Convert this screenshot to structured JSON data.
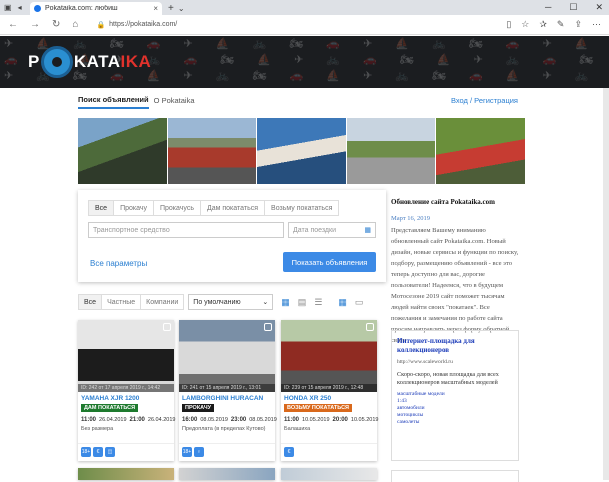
{
  "browser": {
    "tab_title": "Pokataika.com: любиш",
    "url": "https://pokataika.com/",
    "colors": {
      "tabbar": "#dee1e6",
      "accent": "#1a73e8"
    }
  },
  "site": {
    "logo_p": "P",
    "logo_kata": "KATA",
    "logo_ika": "IKA"
  },
  "subnav": {
    "search": "Поиск объявлений",
    "about": "О Pokataika",
    "login": "Вход / Регистрация"
  },
  "search": {
    "tabs": [
      "Все",
      "Прокачу",
      "Прокачусь",
      "Дам покататься",
      "Возьму покататься"
    ],
    "vehicle_placeholder": "Транспортное средство",
    "date_placeholder": "Дата поездки",
    "all_params": "Все параметры",
    "submit": "Показать объявления"
  },
  "filters": {
    "types": [
      "Все",
      "Частные",
      "Компании"
    ],
    "sort": "По умолчанию"
  },
  "news": {
    "title": "Обновление сайта Pokataika.com",
    "date": "Март 16, 2019",
    "body": "Представляем Вашему вниманию обновленный сайт Pokataika.com. Новый дизайн, новые сервисы и функции по поиску, подбору, размещению объявлений - все это теперь доступно для вас, дорогие пользователи! Надеемся, что в будущем Мотосезоне 2019 сайт поможет тысячам людей найти своих \"покатаек\". Все пожелания и замечания по работе сайта просим направлять через форму обратной связи"
  },
  "listings": [
    {
      "name": "YAMAHA XJR 1200",
      "caption": "ID: 242 от 17 апреля 2019 г., 14:42",
      "badge": "ДАМ ПОКАТАТЬСЯ",
      "badge_color": "#1e7a2e",
      "t1": "11:00",
      "d1": "26.04.2019",
      "t2": "21:00",
      "d2": "26.04.2019",
      "sub": "Без размера",
      "icons": [
        "18+",
        "€",
        "◫"
      ]
    },
    {
      "name": "LAMBORGHINI HURACAN",
      "caption": "ID: 241 от 15 апреля 2019 г., 13:01",
      "badge": "ПРОКАЧУ",
      "badge_color": "#1a1a1a",
      "t1": "16:00",
      "d1": "08.05.2019",
      "t2": "23:00",
      "d2": "08.05.2019",
      "sub": "Предоплата (в пределах Кутово)",
      "icons": [
        "18+",
        "♀"
      ]
    },
    {
      "name": "HONDA XR 250",
      "caption": "ID: 239 от 15 апреля 2019 г., 12:48",
      "badge": "ВОЗЬМУ ПОКАТАТЬСЯ",
      "badge_color": "#d9691c",
      "t1": "11:00",
      "d1": "10.05.2019",
      "t2": "20:00",
      "d2": "10.05.2019",
      "sub": "Балашиха",
      "icons": [
        "€"
      ]
    }
  ],
  "ad": {
    "title": "Интернет-площадка для коллекционеров",
    "url": "http://www.scaleworld.ru",
    "body": "Скоро-скоро, новая площадка для всех коллекционеров масштабных моделей",
    "links": [
      "масштабные модели",
      "1:43",
      "автомобили",
      "мотоциклы",
      "самолеты"
    ]
  }
}
